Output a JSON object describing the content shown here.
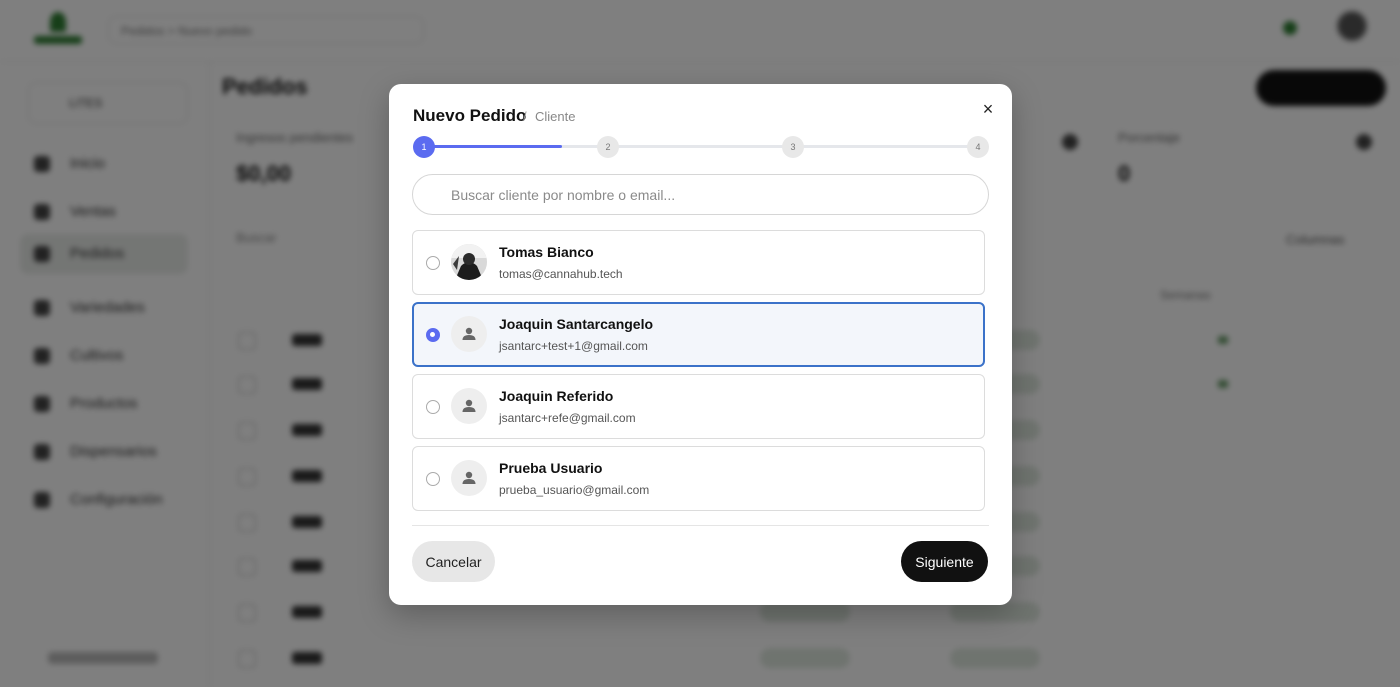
{
  "background": {
    "breadcrumb": "Pedidos > Nuevo pedido",
    "store_label": "LITES",
    "page_title": "Pedidos",
    "nav": [
      {
        "label": "Inicio",
        "icon": "home-icon"
      },
      {
        "label": "Ventas",
        "icon": "chart-icon"
      },
      {
        "label": "Pedidos",
        "icon": "orders-icon"
      },
      {
        "label": "Variedades",
        "icon": "leaf-icon"
      },
      {
        "label": "Cultivos",
        "icon": "plant-icon"
      },
      {
        "label": "Productos",
        "icon": "box-icon"
      },
      {
        "label": "Dispensarios",
        "icon": "store-icon"
      },
      {
        "label": "Configuración",
        "icon": "gear-icon"
      }
    ],
    "stats": [
      {
        "label": "Ingresos pendientes",
        "value": "$0,00"
      },
      {
        "label": "Porcentaje",
        "value": "0"
      }
    ],
    "table_search_placeholder": "Buscar",
    "filter_label": "Columnas",
    "column_header": "Semanas"
  },
  "modal": {
    "title": "Nuevo Pedido",
    "separator": "/",
    "subtitle": "Cliente",
    "close_label": "×",
    "steps": [
      "1",
      "2",
      "3",
      "4"
    ],
    "current_step": 1,
    "step_progress": 0.25,
    "search_placeholder": "Buscar cliente por nombre o email...",
    "search_value": "",
    "clients": [
      {
        "name": "Tomas Bianco",
        "email": "tomas@cannahub.tech",
        "selected": false,
        "avatar": "photo"
      },
      {
        "name": "Joaquin Santarcangelo",
        "email": "jsantarc+test+1@gmail.com",
        "selected": true,
        "avatar": "user-icon"
      },
      {
        "name": "Joaquin Referido",
        "email": "jsantarc+refe@gmail.com",
        "selected": false,
        "avatar": "user-icon"
      },
      {
        "name": "Prueba Usuario",
        "email": "prueba_usuario@gmail.com",
        "selected": false,
        "avatar": "user-icon"
      }
    ],
    "cancel_label": "Cancelar",
    "next_label": "Siguiente"
  },
  "colors": {
    "accent": "#5b6bf0",
    "selected_border": "#3b72c9",
    "primary_button": "#111111",
    "brand_green": "#2e7d32"
  }
}
